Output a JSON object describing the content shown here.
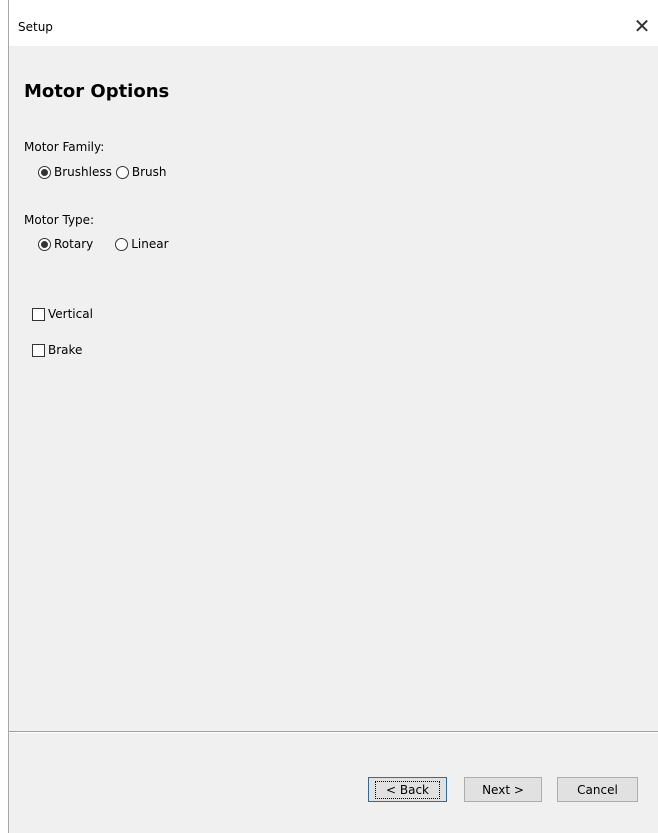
{
  "window": {
    "title": "Setup",
    "close_glyph": "✕"
  },
  "page": {
    "heading": "Motor Options"
  },
  "motor_family": {
    "label": "Motor Family:",
    "options": [
      {
        "label": "Brushless",
        "selected": true
      },
      {
        "label": "Brush",
        "selected": false
      }
    ]
  },
  "motor_type": {
    "label": "Motor Type:",
    "options": [
      {
        "label": "Rotary",
        "selected": true
      },
      {
        "label": "Linear",
        "selected": false
      }
    ]
  },
  "checkboxes": [
    {
      "label": "Vertical",
      "checked": false
    },
    {
      "label": "Brake",
      "checked": false
    }
  ],
  "footer": {
    "back_label": "< Back",
    "next_label": "Next >",
    "cancel_label": "Cancel"
  },
  "colors": {
    "dialog_bg": "#f0f0f0",
    "titlebar_bg": "#ffffff",
    "button_bg": "#e1e1e1",
    "default_button_border": "#0078d7"
  }
}
